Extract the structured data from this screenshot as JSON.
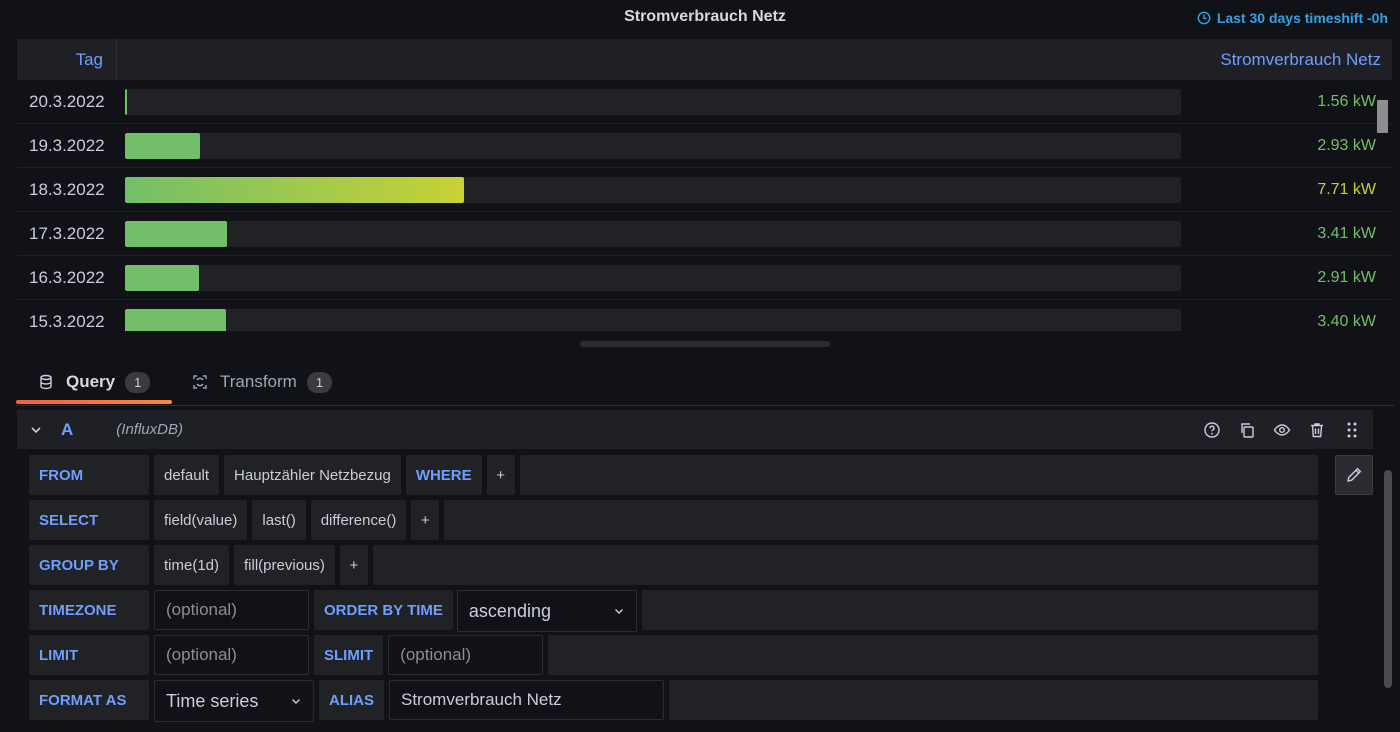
{
  "panel": {
    "title": "Stromverbrauch Netz",
    "timeshift": "Last 30 days timeshift -0h"
  },
  "table": {
    "columns": [
      "Tag",
      "Stromverbrauch Netz"
    ],
    "rows": [
      {
        "date": "20.3.2022",
        "value": "1.56 kW",
        "fraction": 0.0,
        "color": "#73bf69"
      },
      {
        "date": "19.3.2022",
        "value": "2.93 kW",
        "fraction": 0.071,
        "color": "#73bf69"
      },
      {
        "date": "18.3.2022",
        "value": "7.71 kW",
        "fraction": 0.321,
        "color": "#c8d234"
      },
      {
        "date": "17.3.2022",
        "value": "3.41 kW",
        "fraction": 0.097,
        "color": "#73bf69"
      },
      {
        "date": "16.3.2022",
        "value": "2.91 kW",
        "fraction": 0.07,
        "color": "#73bf69"
      },
      {
        "date": "15.3.2022",
        "value": "3.40 kW",
        "fraction": 0.096,
        "color": "#73bf69"
      }
    ]
  },
  "tabs": {
    "query": {
      "label": "Query",
      "count": "1",
      "icon": "database-icon"
    },
    "transform": {
      "label": "Transform",
      "count": "1",
      "icon": "transform-icon"
    }
  },
  "query": {
    "ref_id": "A",
    "datasource": "(InfluxDB)",
    "from": {
      "keyword": "FROM",
      "policy": "default",
      "measurement": "Hauptzähler Netzbezug",
      "where": "WHERE",
      "plus": "+"
    },
    "select": {
      "keyword": "SELECT",
      "parts": [
        "field(value)",
        "last()",
        "difference()"
      ],
      "plus": "+"
    },
    "group_by": {
      "keyword": "GROUP BY",
      "parts": [
        "time(1d)",
        "fill(previous)"
      ],
      "plus": "+"
    },
    "timezone": {
      "keyword": "TIMEZONE",
      "placeholder": "(optional)",
      "order_label": "ORDER BY TIME",
      "order_value": "ascending"
    },
    "limit": {
      "keyword": "LIMIT",
      "placeholder": "(optional)",
      "slimit_label": "SLIMIT",
      "slimit_placeholder": "(optional)"
    },
    "format": {
      "keyword": "FORMAT AS",
      "value": "Time series",
      "alias_label": "ALIAS",
      "alias_value": "Stromverbrauch Netz"
    }
  }
}
